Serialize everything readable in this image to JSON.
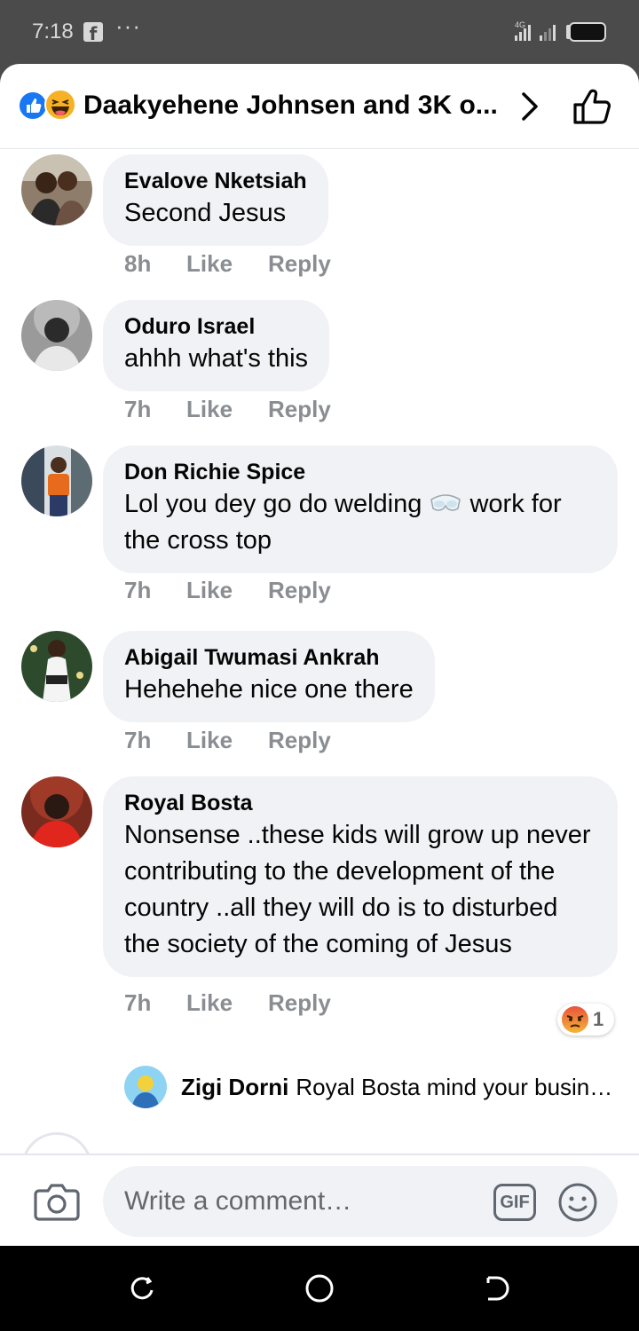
{
  "status_bar": {
    "time": "7:18",
    "app_icon": "facebook-icon",
    "more": "···",
    "network": "4G"
  },
  "header": {
    "title": "Daakyehene Johnsen and 3K o...",
    "reaction_icons": [
      "like-reaction-icon",
      "haha-reaction-icon"
    ]
  },
  "comments": [
    {
      "author": "Evalove Nketsiah",
      "text": "Second Jesus",
      "time": "8h",
      "like": "Like",
      "reply": "Reply"
    },
    {
      "author": "Oduro Israel",
      "text": "ahhh what's this",
      "time": "7h",
      "like": "Like",
      "reply": "Reply"
    },
    {
      "author": "Don Richie Spice",
      "text_before": "Lol you dey go do welding",
      "emoji": "goggles-emoji",
      "text_after": "work for the cross top",
      "time": "7h",
      "like": "Like",
      "reply": "Reply"
    },
    {
      "author": "Abigail Twumasi Ankrah",
      "text": "Hehehehe nice one there",
      "time": "7h",
      "like": "Like",
      "reply": "Reply"
    },
    {
      "author": "Royal Bosta",
      "text": "Nonsense ..these kids will grow up never contributing to the development of the country ..all they will do is to disturbed the society of the coming of Jesus",
      "time": "7h",
      "like": "Like",
      "reply": "Reply",
      "reaction": "angry-reaction-icon",
      "reaction_count": "1",
      "reply_preview": {
        "author": "Zigi Dorni",
        "text": "Royal Bosta mind your busine..."
      }
    }
  ],
  "composer": {
    "placeholder": "Write a comment…",
    "gif_label": "GIF"
  },
  "colors": {
    "bubble": "#f0f2f5",
    "meta": "#8a8d91",
    "facebook_blue": "#1877f2"
  }
}
